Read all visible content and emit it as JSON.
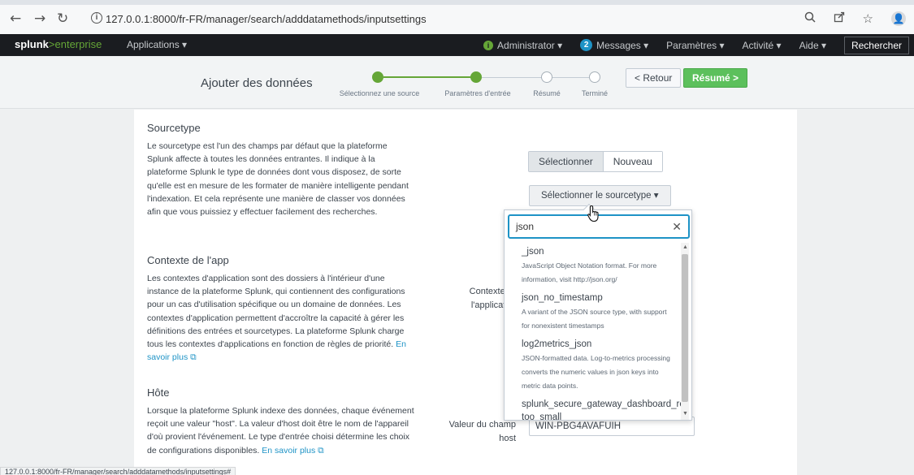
{
  "browser": {
    "url": "127.0.0.1:8000/fr-FR/manager/search/adddatamethods/inputsettings",
    "status_url": "127.0.0.1:8000/fr-FR/manager/search/adddatamethods/inputsettings#"
  },
  "splunk_nav": {
    "logo_primary": "splunk",
    "logo_secondary": ">enterprise",
    "applications": "Applications ▾",
    "administrator": "Administrator ▾",
    "messages_count": "2",
    "messages": "Messages ▾",
    "parametres": "Paramètres ▾",
    "activite": "Activité ▾",
    "aide": "Aide ▾",
    "search": "Rechercher"
  },
  "wizard": {
    "title": "Ajouter des données",
    "steps": [
      {
        "label": "Sélectionnez une source",
        "done": true
      },
      {
        "label": "Paramètres d'entrée",
        "done": true
      },
      {
        "label": "Résumé",
        "done": false
      },
      {
        "label": "Terminé",
        "done": false
      }
    ],
    "back": "< Retour",
    "next": "Résumé >"
  },
  "sourcetype": {
    "title": "Sourcetype",
    "description": "Le sourcetype est l'un des champs par défaut que la plateforme Splunk affecte à toutes les données entrantes. Il indique à la plateforme Splunk le type de données dont vous disposez, de sorte qu'elle est en mesure de les formater de manière intelligente pendant l'indexation. Et cela représente une manière de classer vos données afin que vous puissiez y effectuer facilement des recherches.",
    "select_btn": "Sélectionner",
    "new_btn": "Nouveau",
    "dropdown": "Sélectionner le sourcetype ▾"
  },
  "app_context": {
    "title": "Contexte de l'app",
    "description": "Les contextes d'application sont des dossiers à l'intérieur d'une instance de la plateforme Splunk, qui contiennent des configurations pour un cas d'utilisation spécifique ou un domaine de données. Les contextes d'application permettent d'accroître la capacité à gérer les définitions des entrées et sourcetypes. La plateforme Splunk charge tous les contextes d'applications en fonction de règles de priorité.",
    "learn_more": "En savoir plus ⧉",
    "field_label": "Contexte de l'application"
  },
  "host": {
    "title": "Hôte",
    "description": "Lorsque la plateforme Splunk indexe des données, chaque événement reçoit une valeur \"host\". La valeur d'host doit être le nom de l'appareil d'où provient l'événement. Le type d'entrée choisi détermine les choix de configurations disponibles.",
    "learn_more": "En savoir plus ⧉",
    "field_label": "Valeur du champ host",
    "value": "WIN-PBG4AVAFUIH"
  },
  "popup": {
    "search_value": "json",
    "items": [
      {
        "name": "_json",
        "desc": "JavaScript Object Notation format. For more information, visit http://json.org/"
      },
      {
        "name": "json_no_timestamp",
        "desc": "A variant of the JSON source type, with support for nonexistent timestamps"
      },
      {
        "name": "log2metrics_json",
        "desc": "JSON-formatted data. Log-to-metrics processing converts the numeric values in json keys into metric data points."
      },
      {
        "name": "splunk_secure_gateway_dashboard_request_json-too_small",
        "desc": ""
      }
    ]
  }
}
